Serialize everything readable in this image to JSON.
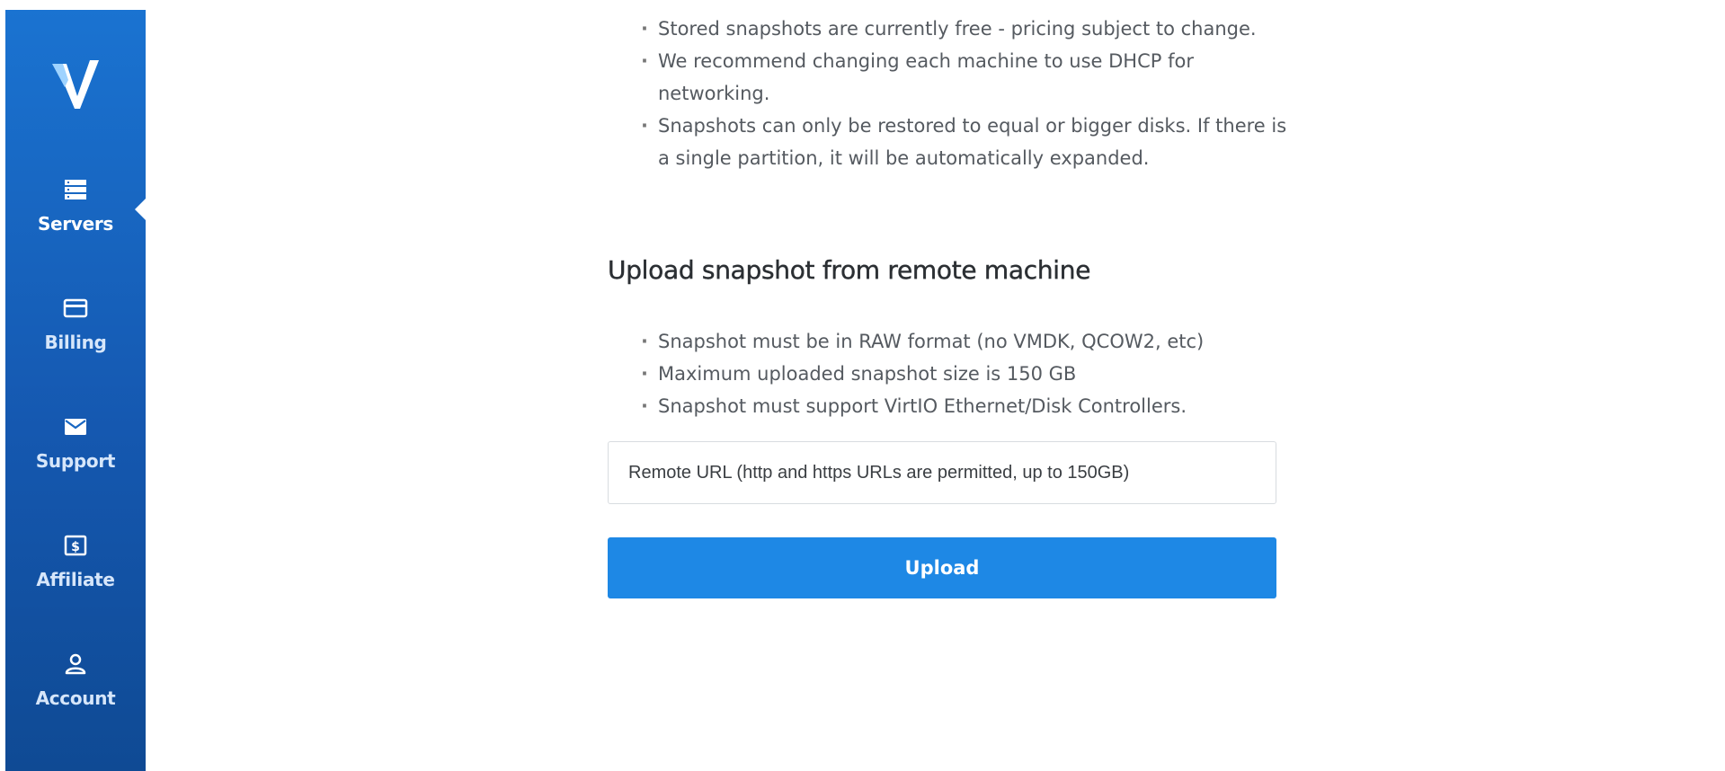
{
  "sidebar": {
    "logo_icon": "vultr-logo-icon",
    "items": [
      {
        "label": "Servers",
        "icon": "server-stack-icon",
        "active": true
      },
      {
        "label": "Billing",
        "icon": "credit-card-icon",
        "active": false
      },
      {
        "label": "Support",
        "icon": "envelope-icon",
        "active": false
      },
      {
        "label": "Affiliate",
        "icon": "dollar-badge-icon",
        "active": false
      },
      {
        "label": "Account",
        "icon": "user-icon",
        "active": false
      }
    ],
    "colors": {
      "background_top": "#1a73d1",
      "background_bottom": "#0f4a94"
    }
  },
  "main": {
    "snapshot_notes": [
      "Stored snapshots are currently free - pricing subject to change.",
      "We recommend changing each machine to use DHCP for networking.",
      "Snapshots can only be restored to equal or bigger disks. If there is a single partition, it will be automatically expanded."
    ],
    "upload_section": {
      "title": "Upload snapshot from remote machine",
      "requirements": [
        "Snapshot must be in RAW format (no VMDK, QCOW2, etc)",
        "Maximum uploaded snapshot size is 150 GB",
        "Snapshot must support VirtIO Ethernet/Disk Controllers."
      ],
      "url_placeholder": "Remote URL (http and https URLs are permitted, up to 150GB)",
      "url_value": "",
      "upload_label": "Upload",
      "button_color": "#1e88e5"
    }
  }
}
